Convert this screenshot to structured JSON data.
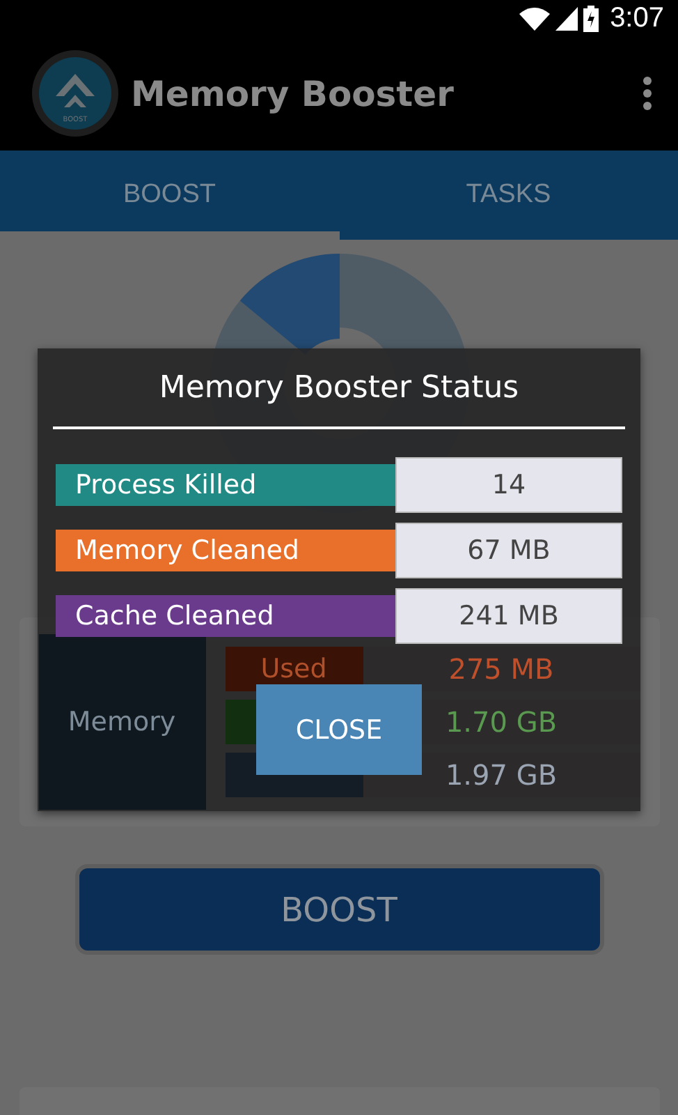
{
  "status_bar": {
    "time": "3:07"
  },
  "app_bar": {
    "logo_text": "BOOST",
    "title": "Memory Booster"
  },
  "tabs": [
    {
      "label": "BOOST",
      "selected": true
    },
    {
      "label": "TASKS",
      "selected": false
    }
  ],
  "memory_card": {
    "title": "Memory",
    "rows": [
      {
        "label": "Used",
        "value": "275 MB",
        "color": "#3a1206"
      },
      {
        "value": "1.70 GB",
        "color": "#12300f"
      },
      {
        "value": "1.97 GB",
        "color": "#141c26"
      }
    ]
  },
  "boost_button": {
    "label": "BOOST"
  },
  "dialog": {
    "title": "Memory Booster Status",
    "rows": [
      {
        "label": "Process Killed",
        "value": "14",
        "color": "#218a84"
      },
      {
        "label": "Memory Cleaned",
        "value": "67 MB",
        "color": "#e8702a"
      },
      {
        "label": "Cache Cleaned",
        "value": "241 MB",
        "color": "#6a3a8c"
      }
    ],
    "close_button": {
      "label": "CLOSE"
    }
  }
}
